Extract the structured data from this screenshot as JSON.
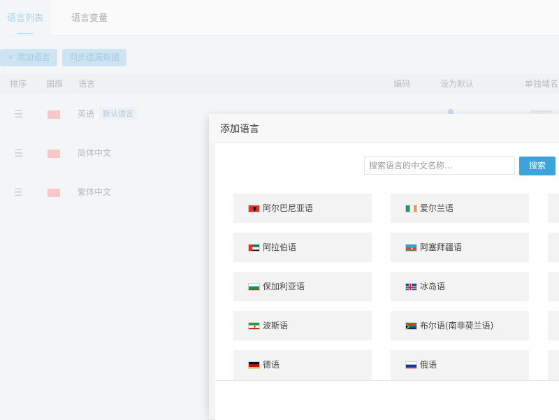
{
  "bg": {
    "tabs": [
      "语言列表",
      "语言变量"
    ],
    "add_button": "+ 添加语言",
    "sync_button": "同步遗漏数据",
    "columns": [
      "排序",
      "国旗",
      "语言",
      "编码",
      "设为默认",
      "单独域名"
    ],
    "rows": [
      {
        "handle": "☰",
        "name": "英语",
        "tag": "默认语言"
      },
      {
        "handle": "☰",
        "name": "简体中文"
      },
      {
        "handle": "☰",
        "name": "繁体中文"
      }
    ]
  },
  "modal": {
    "title": "添加语言",
    "search_placeholder": "搜索语言的中文名称...",
    "search_button": "搜索",
    "languages": [
      {
        "name": "阿尔巴尼亚语",
        "flag": "albania"
      },
      {
        "name": "爱尔兰语",
        "flag": "ireland"
      },
      {
        "name": "阿拉伯语",
        "flag": "uae"
      },
      {
        "name": "阿塞拜疆语",
        "flag": "azerbaijan"
      },
      {
        "name": "保加利亚语",
        "flag": "bulgaria"
      },
      {
        "name": "冰岛语",
        "flag": "iceland"
      },
      {
        "name": "波斯语",
        "flag": "iran"
      },
      {
        "name": "布尔语(南非荷兰语)",
        "flag": "south-africa"
      },
      {
        "name": "德语",
        "flag": "germany"
      },
      {
        "name": "俄语",
        "flag": "russia"
      }
    ]
  },
  "colors": {
    "accent": "#3da3db",
    "card_bg": "#f3f3f3"
  }
}
